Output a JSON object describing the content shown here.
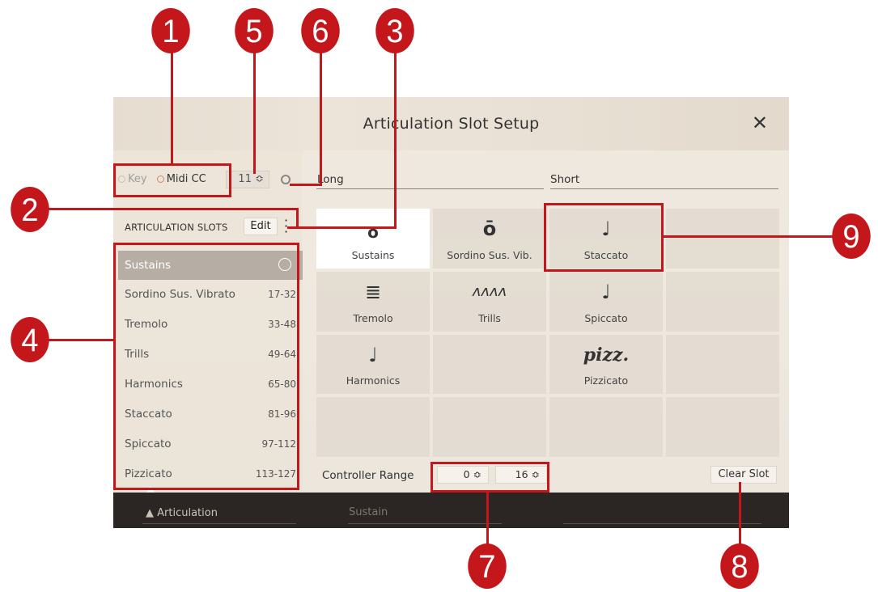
{
  "dialog": {
    "title": "Articulation Slot Setup",
    "close_label": "✕"
  },
  "trigger": {
    "key_label": "Key",
    "midi_label": "Midi CC",
    "cc_value": "11 ≎"
  },
  "slots": {
    "header": "ARTICULATION SLOTS",
    "edit_label": "Edit",
    "items": [
      {
        "label": "Sustains",
        "range": ""
      },
      {
        "label": "Sordino Sus. Vibrato",
        "range": "17-32"
      },
      {
        "label": "Tremolo",
        "range": "33-48"
      },
      {
        "label": "Trills",
        "range": "49-64"
      },
      {
        "label": "Harmonics",
        "range": "65-80"
      },
      {
        "label": "Staccato",
        "range": "81-96"
      },
      {
        "label": "Spiccato",
        "range": "97-112"
      },
      {
        "label": "Pizzicato",
        "range": "113-127"
      }
    ]
  },
  "categories": {
    "long": "Long",
    "short": "Short"
  },
  "grid": {
    "cells": [
      {
        "label": "Sustains",
        "icon": "o"
      },
      {
        "label": "Sordino Sus. Vib.",
        "icon": "ō"
      },
      {
        "label": "Staccato",
        "icon": "♩"
      },
      {
        "label": "",
        "icon": ""
      },
      {
        "label": "Tremolo",
        "icon": "≣"
      },
      {
        "label": "Trills",
        "icon": "ʌʌʌʌ"
      },
      {
        "label": "Spiccato",
        "icon": "♩"
      },
      {
        "label": "",
        "icon": ""
      },
      {
        "label": "Harmonics",
        "icon": "♩"
      },
      {
        "label": "",
        "icon": ""
      },
      {
        "label": "Pizzicato",
        "icon": "pizz."
      },
      {
        "label": "",
        "icon": ""
      }
    ]
  },
  "controller": {
    "label": "Controller Range",
    "min": "0 ≎",
    "max": "16 ≎",
    "clear_label": "Clear Slot"
  },
  "bottom_bar": {
    "tab_articulation": "▲ Articulation",
    "tab_sustain": "Sustain"
  },
  "callouts": {
    "c1": "1",
    "c2": "2",
    "c3": "3",
    "c4": "4",
    "c5": "5",
    "c6": "6",
    "c7": "7",
    "c8": "8",
    "c9": "9"
  },
  "colors": {
    "annotation_red": "#c4171c",
    "selected_slot_bg": "#b6aea4",
    "bottom_bar_bg": "#2b2623"
  }
}
